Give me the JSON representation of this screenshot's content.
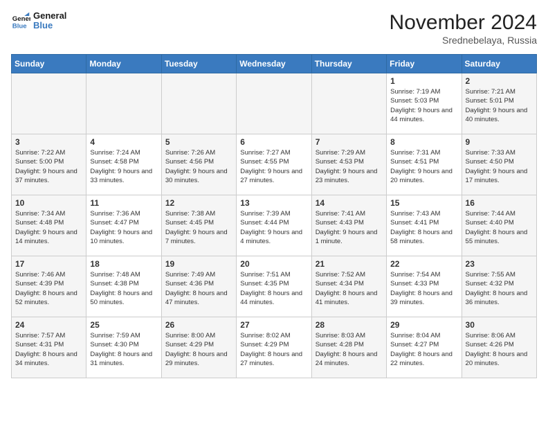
{
  "logo": {
    "line1": "General",
    "line2": "Blue"
  },
  "title": "November 2024",
  "location": "Srednebelaya, Russia",
  "days_of_week": [
    "Sunday",
    "Monday",
    "Tuesday",
    "Wednesday",
    "Thursday",
    "Friday",
    "Saturday"
  ],
  "weeks": [
    [
      {
        "day": "",
        "info": ""
      },
      {
        "day": "",
        "info": ""
      },
      {
        "day": "",
        "info": ""
      },
      {
        "day": "",
        "info": ""
      },
      {
        "day": "",
        "info": ""
      },
      {
        "day": "1",
        "info": "Sunrise: 7:19 AM\nSunset: 5:03 PM\nDaylight: 9 hours and 44 minutes."
      },
      {
        "day": "2",
        "info": "Sunrise: 7:21 AM\nSunset: 5:01 PM\nDaylight: 9 hours and 40 minutes."
      }
    ],
    [
      {
        "day": "3",
        "info": "Sunrise: 7:22 AM\nSunset: 5:00 PM\nDaylight: 9 hours and 37 minutes."
      },
      {
        "day": "4",
        "info": "Sunrise: 7:24 AM\nSunset: 4:58 PM\nDaylight: 9 hours and 33 minutes."
      },
      {
        "day": "5",
        "info": "Sunrise: 7:26 AM\nSunset: 4:56 PM\nDaylight: 9 hours and 30 minutes."
      },
      {
        "day": "6",
        "info": "Sunrise: 7:27 AM\nSunset: 4:55 PM\nDaylight: 9 hours and 27 minutes."
      },
      {
        "day": "7",
        "info": "Sunrise: 7:29 AM\nSunset: 4:53 PM\nDaylight: 9 hours and 23 minutes."
      },
      {
        "day": "8",
        "info": "Sunrise: 7:31 AM\nSunset: 4:51 PM\nDaylight: 9 hours and 20 minutes."
      },
      {
        "day": "9",
        "info": "Sunrise: 7:33 AM\nSunset: 4:50 PM\nDaylight: 9 hours and 17 minutes."
      }
    ],
    [
      {
        "day": "10",
        "info": "Sunrise: 7:34 AM\nSunset: 4:48 PM\nDaylight: 9 hours and 14 minutes."
      },
      {
        "day": "11",
        "info": "Sunrise: 7:36 AM\nSunset: 4:47 PM\nDaylight: 9 hours and 10 minutes."
      },
      {
        "day": "12",
        "info": "Sunrise: 7:38 AM\nSunset: 4:45 PM\nDaylight: 9 hours and 7 minutes."
      },
      {
        "day": "13",
        "info": "Sunrise: 7:39 AM\nSunset: 4:44 PM\nDaylight: 9 hours and 4 minutes."
      },
      {
        "day": "14",
        "info": "Sunrise: 7:41 AM\nSunset: 4:43 PM\nDaylight: 9 hours and 1 minute."
      },
      {
        "day": "15",
        "info": "Sunrise: 7:43 AM\nSunset: 4:41 PM\nDaylight: 8 hours and 58 minutes."
      },
      {
        "day": "16",
        "info": "Sunrise: 7:44 AM\nSunset: 4:40 PM\nDaylight: 8 hours and 55 minutes."
      }
    ],
    [
      {
        "day": "17",
        "info": "Sunrise: 7:46 AM\nSunset: 4:39 PM\nDaylight: 8 hours and 52 minutes."
      },
      {
        "day": "18",
        "info": "Sunrise: 7:48 AM\nSunset: 4:38 PM\nDaylight: 8 hours and 50 minutes."
      },
      {
        "day": "19",
        "info": "Sunrise: 7:49 AM\nSunset: 4:36 PM\nDaylight: 8 hours and 47 minutes."
      },
      {
        "day": "20",
        "info": "Sunrise: 7:51 AM\nSunset: 4:35 PM\nDaylight: 8 hours and 44 minutes."
      },
      {
        "day": "21",
        "info": "Sunrise: 7:52 AM\nSunset: 4:34 PM\nDaylight: 8 hours and 41 minutes."
      },
      {
        "day": "22",
        "info": "Sunrise: 7:54 AM\nSunset: 4:33 PM\nDaylight: 8 hours and 39 minutes."
      },
      {
        "day": "23",
        "info": "Sunrise: 7:55 AM\nSunset: 4:32 PM\nDaylight: 8 hours and 36 minutes."
      }
    ],
    [
      {
        "day": "24",
        "info": "Sunrise: 7:57 AM\nSunset: 4:31 PM\nDaylight: 8 hours and 34 minutes."
      },
      {
        "day": "25",
        "info": "Sunrise: 7:59 AM\nSunset: 4:30 PM\nDaylight: 8 hours and 31 minutes."
      },
      {
        "day": "26",
        "info": "Sunrise: 8:00 AM\nSunset: 4:29 PM\nDaylight: 8 hours and 29 minutes."
      },
      {
        "day": "27",
        "info": "Sunrise: 8:02 AM\nSunset: 4:29 PM\nDaylight: 8 hours and 27 minutes."
      },
      {
        "day": "28",
        "info": "Sunrise: 8:03 AM\nSunset: 4:28 PM\nDaylight: 8 hours and 24 minutes."
      },
      {
        "day": "29",
        "info": "Sunrise: 8:04 AM\nSunset: 4:27 PM\nDaylight: 8 hours and 22 minutes."
      },
      {
        "day": "30",
        "info": "Sunrise: 8:06 AM\nSunset: 4:26 PM\nDaylight: 8 hours and 20 minutes."
      }
    ]
  ]
}
